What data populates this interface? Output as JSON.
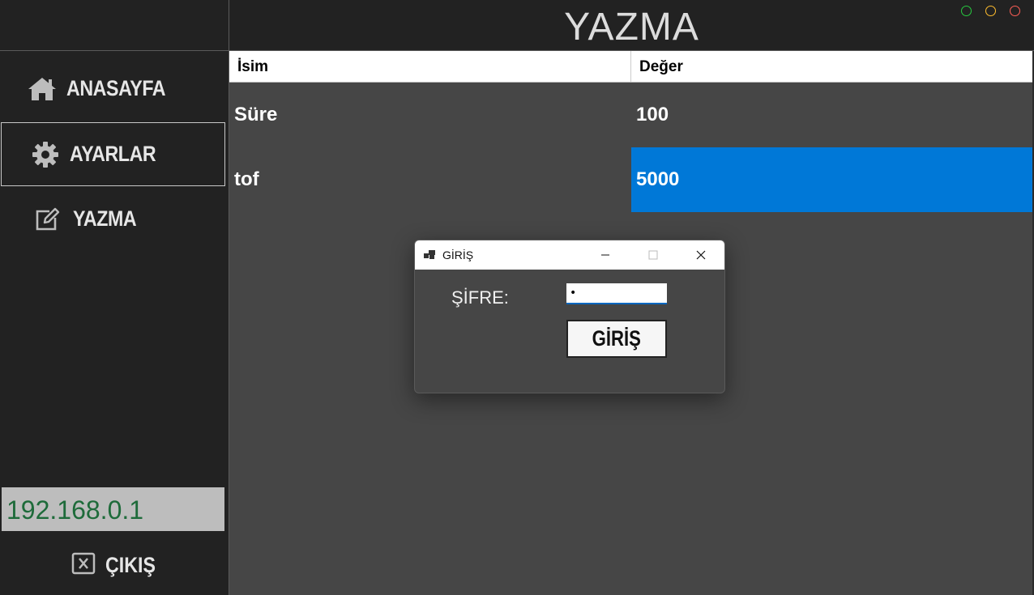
{
  "app": {
    "page_title": "YAZMA",
    "window_controls": {
      "colors": {
        "green": "#27c93f",
        "yellow": "#ffbd2e",
        "red": "#ff5f56"
      }
    }
  },
  "sidebar": {
    "items": [
      {
        "label": "ANASAYFA",
        "icon": "home-icon",
        "active": false
      },
      {
        "label": "AYARLAR",
        "icon": "gear-icon",
        "active": true
      },
      {
        "label": "YAZMA",
        "icon": "edit-icon",
        "active": false
      }
    ],
    "ip_address": "192.168.0.1",
    "exit_label": "ÇIKIŞ"
  },
  "grid": {
    "columns": [
      "İsim",
      "Değer"
    ],
    "rows": [
      {
        "name": "Süre",
        "value": "100"
      },
      {
        "name": "tof",
        "value": "5000",
        "selected": true
      }
    ],
    "selection_color": "#0078d7"
  },
  "dialog": {
    "title": "GİRİŞ",
    "password_label": "ŞİFRE:",
    "password_value": "•",
    "button_label": "GİRİŞ"
  }
}
